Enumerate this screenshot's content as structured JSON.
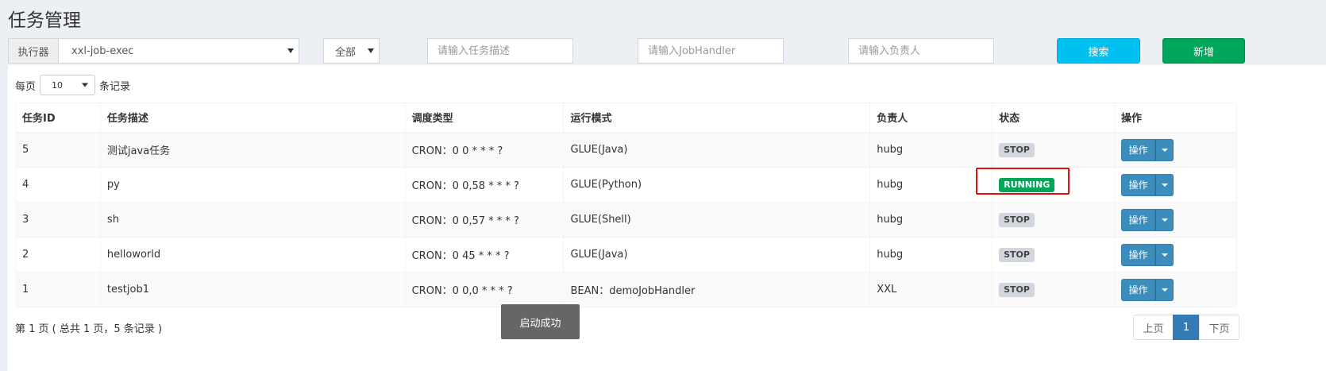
{
  "page": {
    "title": "任务管理"
  },
  "filters": {
    "executor_label": "执行器",
    "executor_value": "xxl-job-exec",
    "status_value": "全部",
    "desc_placeholder": "请输入任务描述",
    "handler_placeholder": "请输入JobHandler",
    "owner_placeholder": "请输入负责人",
    "search_label": "搜索",
    "add_label": "新增"
  },
  "page_size": {
    "prefix": "每页",
    "value": "10",
    "suffix": "条记录"
  },
  "table": {
    "headers": [
      "任务ID",
      "任务描述",
      "调度类型",
      "运行模式",
      "负责人",
      "状态",
      "操作"
    ],
    "rows": [
      {
        "id": "5",
        "desc": "测试java任务",
        "schedule": "CRON：0 0 * * * ?",
        "mode": "GLUE(Java)",
        "owner": "hubg",
        "status": "STOP",
        "op": "操作"
      },
      {
        "id": "4",
        "desc": "py",
        "schedule": "CRON：0 0,58 * * * ?",
        "mode": "GLUE(Python)",
        "owner": "hubg",
        "status": "RUNNING",
        "op": "操作"
      },
      {
        "id": "3",
        "desc": "sh",
        "schedule": "CRON：0 0,57 * * * ?",
        "mode": "GLUE(Shell)",
        "owner": "hubg",
        "status": "STOP",
        "op": "操作"
      },
      {
        "id": "2",
        "desc": "helloworld",
        "schedule": "CRON：0 45 * * * ?",
        "mode": "GLUE(Java)",
        "owner": "hubg",
        "status": "STOP",
        "op": "操作"
      },
      {
        "id": "1",
        "desc": "testjob1",
        "schedule": "CRON：0 0,0 * * * ?",
        "mode": "BEAN：demoJobHandler",
        "owner": "XXL",
        "status": "STOP",
        "op": "操作"
      }
    ]
  },
  "footer": {
    "info": "第 1 页 ( 总共 1 页，5 条记录 )",
    "prev": "上页",
    "current": "1",
    "next": "下页"
  },
  "toast": {
    "message": "启动成功"
  },
  "colors": {
    "search": "#00c0ef",
    "add": "#00a65a",
    "op": "#3c8dbc",
    "running": "#00a65a",
    "stop": "#d2d6de",
    "highlight": "#e01010"
  }
}
